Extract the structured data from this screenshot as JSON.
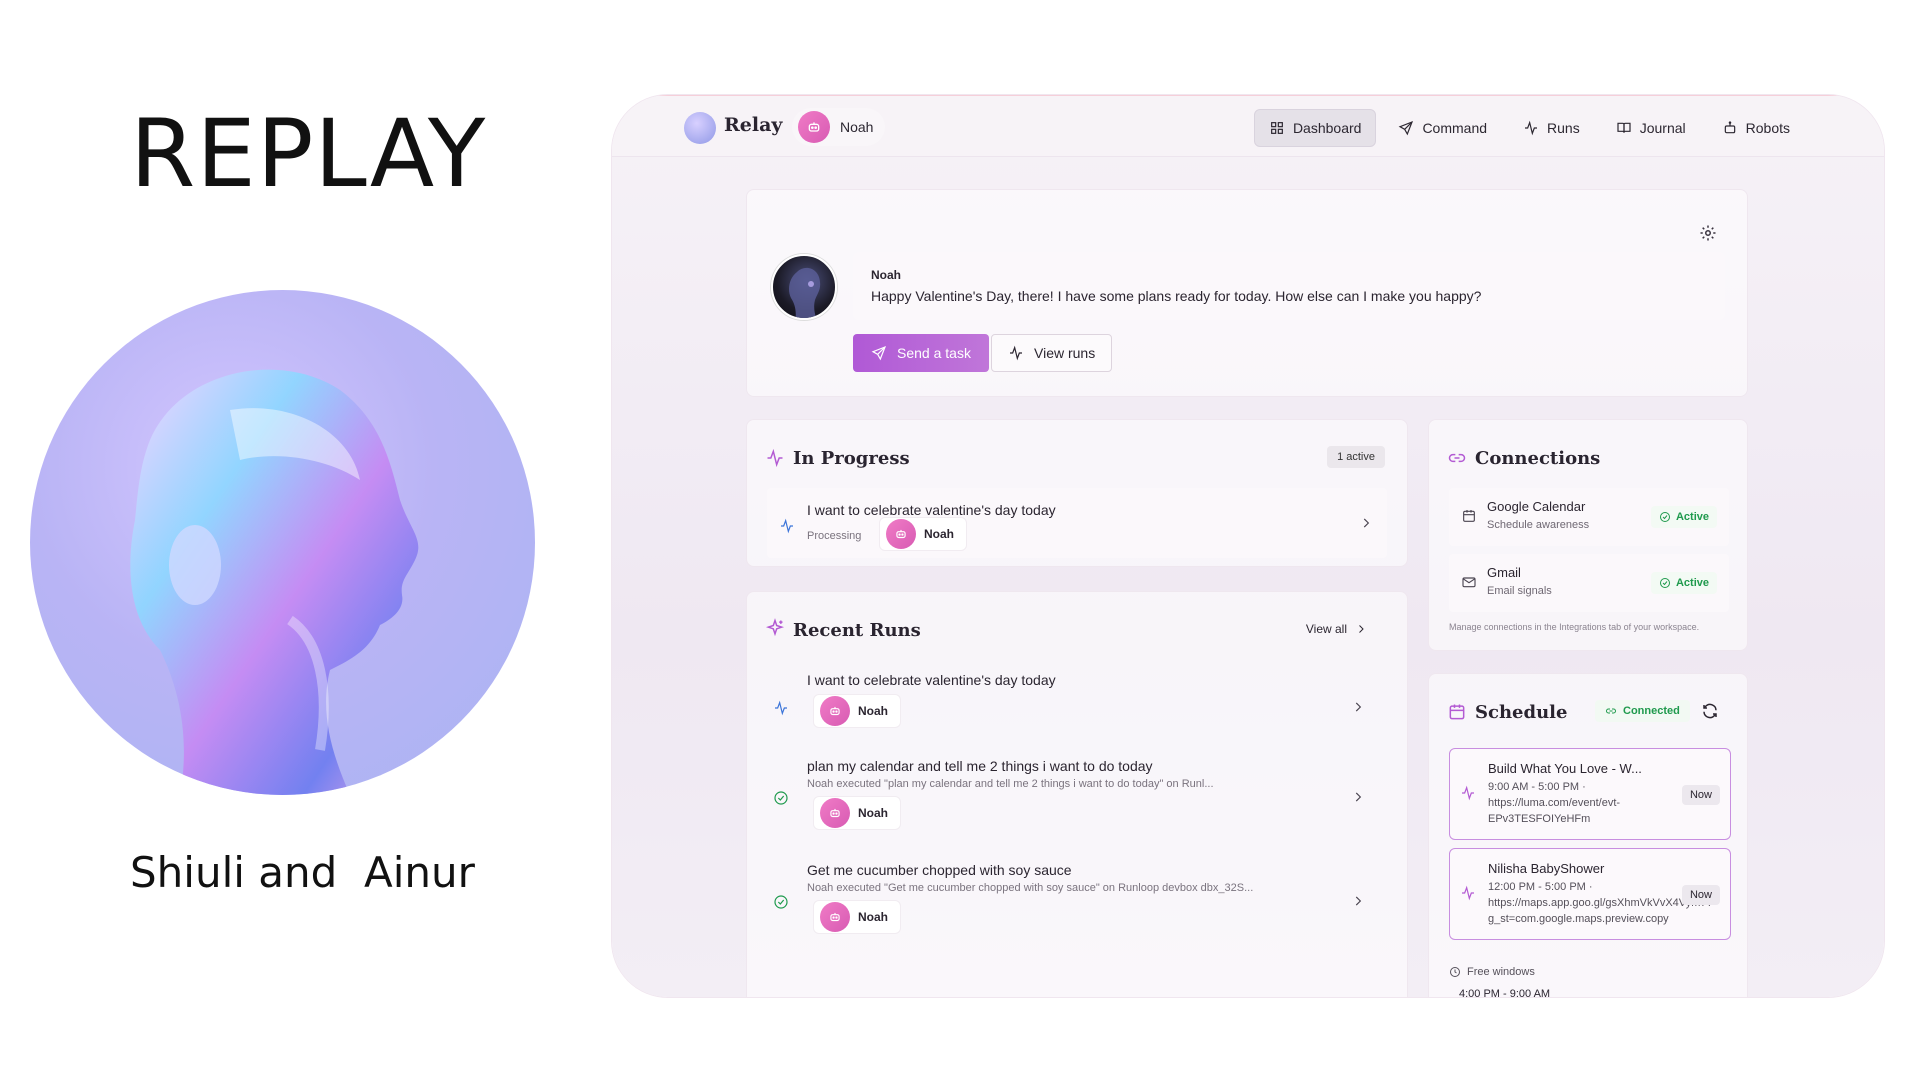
{
  "slide": {
    "title": "REPLAY",
    "authors": "Shiuli and  Ainur"
  },
  "app": {
    "name": "Relay",
    "agent_name": "Noah",
    "nav": [
      {
        "label": "Dashboard",
        "icon": "grid-icon",
        "active": true
      },
      {
        "label": "Command",
        "icon": "send-icon"
      },
      {
        "label": "Runs",
        "icon": "activity-icon"
      },
      {
        "label": "Journal",
        "icon": "book-icon"
      },
      {
        "label": "Robots",
        "icon": "robot-icon"
      }
    ]
  },
  "greeting": {
    "sender": "Noah",
    "message": "Happy Valentine's Day, there! I have some plans ready for today. How else can I make you happy?",
    "primary_button": "Send a task",
    "secondary_button": "View runs"
  },
  "in_progress": {
    "title": "In Progress",
    "badge": "1 active",
    "item": {
      "title": "I want to celebrate valentine's day today",
      "status": "Processing",
      "agent": "Noah"
    }
  },
  "recent_runs": {
    "title": "Recent Runs",
    "view_all": "View all",
    "items": [
      {
        "title": "I want to celebrate valentine's day today",
        "detail": "",
        "agent": "Noah",
        "status": "processing"
      },
      {
        "title": "plan my calendar and tell me 2 things i want to do today",
        "detail": "Noah executed \"plan my calendar and tell me 2 things i want to do today\" on Runl...",
        "agent": "Noah",
        "status": "success"
      },
      {
        "title": "Get me cucumber chopped with soy sauce",
        "detail": "Noah executed \"Get me cucumber chopped with soy sauce\" on Runloop devbox dbx_32S...",
        "agent": "Noah",
        "status": "success"
      }
    ]
  },
  "connections": {
    "title": "Connections",
    "items": [
      {
        "name": "Google Calendar",
        "desc": "Schedule awareness",
        "status": "Active"
      },
      {
        "name": "Gmail",
        "desc": "Email signals",
        "status": "Active"
      }
    ],
    "footer": "Manage connections in the Integrations tab of your workspace."
  },
  "schedule": {
    "title": "Schedule",
    "status": "Connected",
    "events": [
      {
        "title": "Build What You Love - W...",
        "time": "9:00 AM - 5:00 PM ·",
        "link1": "https://luma.com/event/evt-",
        "link2": "EPv3TESFOIYeHFm",
        "badge": "Now"
      },
      {
        "title": "Nilisha BabyShower",
        "time": "12:00 PM - 5:00 PM ·",
        "link1": "https://maps.app.goo.gl/gsXhmVkVvX4Vym7?",
        "link2": "g_st=com.google.maps.preview.copy",
        "badge": "Now"
      }
    ],
    "free_label": "Free windows",
    "free_value": "4:00 PM - 9:00 AM"
  },
  "colors": {
    "accent": "#b35ad3",
    "active_green": "#1f9a4d",
    "bot_pink": "#e06bbd"
  }
}
